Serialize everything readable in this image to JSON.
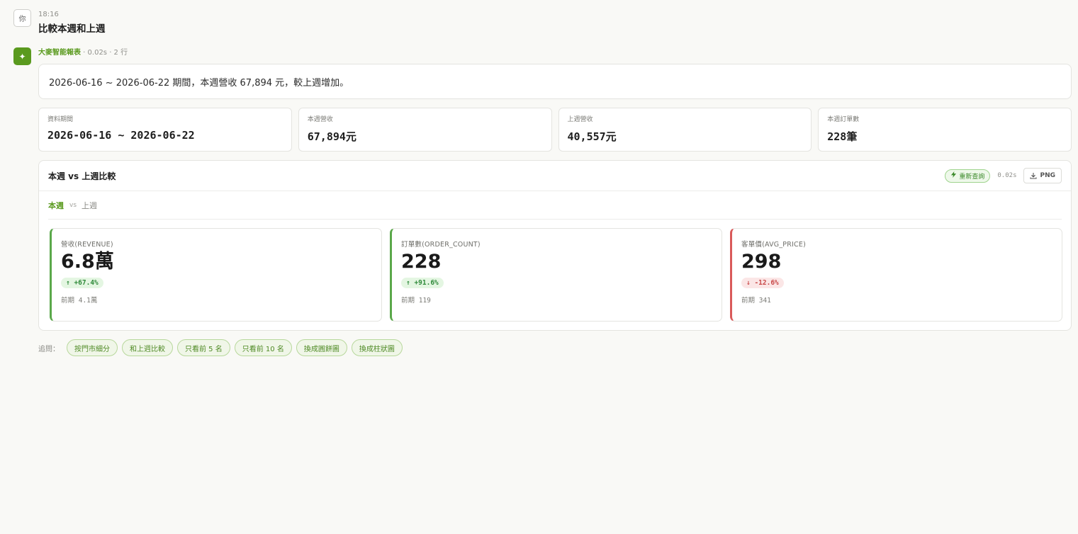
{
  "user_message": {
    "avatar": "你",
    "time": "18:16",
    "text": "比較本週和上週"
  },
  "assistant": {
    "avatar_icon": "sparkle-icon",
    "name": "大麥智能報表",
    "meta": " · 0.02s · 2 行",
    "answer": "2026-06-16 ~ 2026-06-22 期間，本週營收 67,894 元，較上週增加。"
  },
  "kpis": [
    {
      "label": "資料期間",
      "value": "2026-06-16 ~ 2026-06-22"
    },
    {
      "label": "本週營收",
      "value": "67,894元"
    },
    {
      "label": "上週營收",
      "value": "40,557元"
    },
    {
      "label": "本週訂單數",
      "value": "228筆"
    }
  ],
  "panel": {
    "title": "本週 vs 上週比較",
    "refresh_label": "重新查詢",
    "elapsed": "0.02s",
    "png_label": "PNG",
    "legend_current": "本週",
    "legend_vs": "vs",
    "legend_prev": "上週"
  },
  "metrics": [
    {
      "label": "營收(REVENUE)",
      "value": "6.8萬",
      "delta": "↑ +67.4%",
      "direction": "up",
      "prev": "前期 4.1萬"
    },
    {
      "label": "訂單數(ORDER_COUNT)",
      "value": "228",
      "delta": "↑ +91.6%",
      "direction": "up",
      "prev": "前期 119"
    },
    {
      "label": "客單價(AVG_PRICE)",
      "value": "298",
      "delta": "↓ -12.6%",
      "direction": "down",
      "prev": "前期 341"
    }
  ],
  "followup": {
    "label": "追問：",
    "chips": [
      "按門市細分",
      "和上週比較",
      "只看前 5 名",
      "只看前 10 名",
      "換成圓餅圖",
      "換成柱狀圖"
    ]
  },
  "colors": {
    "brand_green": "#5a9a1e",
    "positive": "#2f8a3a",
    "negative": "#c84848"
  }
}
